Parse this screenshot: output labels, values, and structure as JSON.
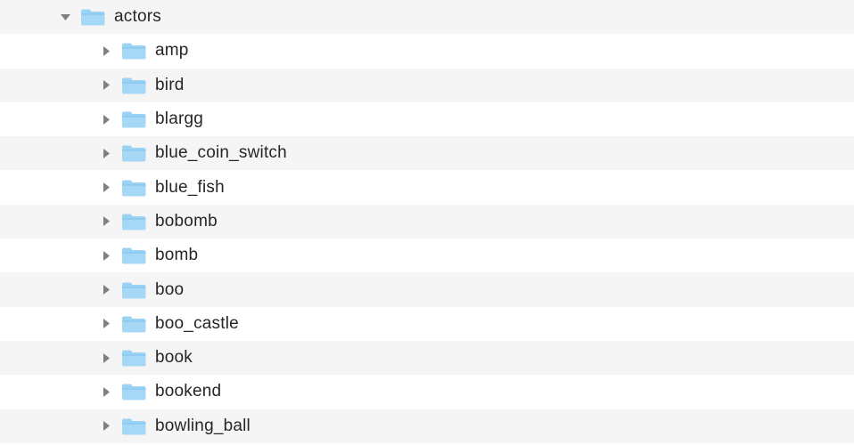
{
  "tree": {
    "root": {
      "name": "actors",
      "expanded": true,
      "children": [
        {
          "name": "amp",
          "expanded": false
        },
        {
          "name": "bird",
          "expanded": false
        },
        {
          "name": "blargg",
          "expanded": false
        },
        {
          "name": "blue_coin_switch",
          "expanded": false
        },
        {
          "name": "blue_fish",
          "expanded": false
        },
        {
          "name": "bobomb",
          "expanded": false
        },
        {
          "name": "bomb",
          "expanded": false
        },
        {
          "name": "boo",
          "expanded": false
        },
        {
          "name": "boo_castle",
          "expanded": false
        },
        {
          "name": "book",
          "expanded": false
        },
        {
          "name": "bookend",
          "expanded": false
        },
        {
          "name": "bowling_ball",
          "expanded": false
        }
      ]
    }
  },
  "icons": {
    "folder": "folder-icon",
    "chevron_right": "chevron-right-icon",
    "chevron_down": "chevron-down-icon"
  }
}
